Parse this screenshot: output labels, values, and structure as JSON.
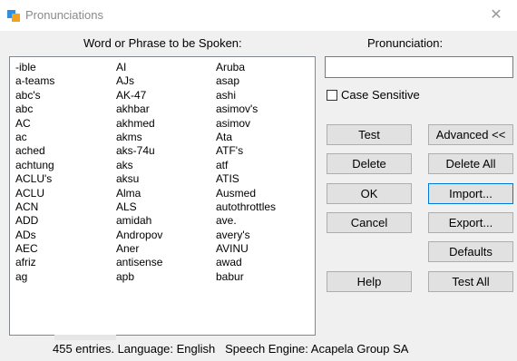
{
  "window": {
    "title": "Pronunciations",
    "close_glyph": "✕"
  },
  "labels": {
    "word_header": "Word or Phrase to be Spoken:",
    "pronunciation_header": "Pronunciation:"
  },
  "pronunciation_input": {
    "value": ""
  },
  "case_sensitive": {
    "label": "Case Sensitive",
    "checked": false
  },
  "buttons": {
    "test": "Test",
    "advanced": "Advanced <<",
    "delete": "Delete",
    "delete_all": "Delete All",
    "ok": "OK",
    "import": "Import...",
    "cancel": "Cancel",
    "export": "Export...",
    "defaults": "Defaults",
    "help": "Help",
    "test_all": "Test All"
  },
  "entries": {
    "col1": [
      "-ible",
      "a-teams",
      "abc's",
      "abc",
      "AC",
      "ac",
      "ached",
      "achtung",
      "ACLU's",
      "ACLU",
      "ACN",
      "ADD",
      "ADs",
      "AEC",
      "afriz",
      "ag"
    ],
    "col2": [
      "AI",
      "AJs",
      "AK-47",
      "akhbar",
      "akhmed",
      "akms",
      "aks-74u",
      "aks",
      "aksu",
      "Alma",
      "ALS",
      "amidah",
      "Andropov",
      "Aner",
      "antisense",
      "apb"
    ],
    "col3": [
      "Aruba",
      "asap",
      "ashi",
      "asimov's",
      "asimov",
      "Ata",
      "ATF's",
      "atf",
      "ATIS",
      "Ausmed",
      "autothrottles",
      "ave.",
      "avery's",
      "AVINU",
      "awad",
      "babur"
    ]
  },
  "status": {
    "entries": "455 entries.",
    "language": "Language: English",
    "engine": "Speech Engine: Acapela Group SA"
  },
  "colors": {
    "focus": "#0078d7",
    "background": "#f0f0f0"
  }
}
